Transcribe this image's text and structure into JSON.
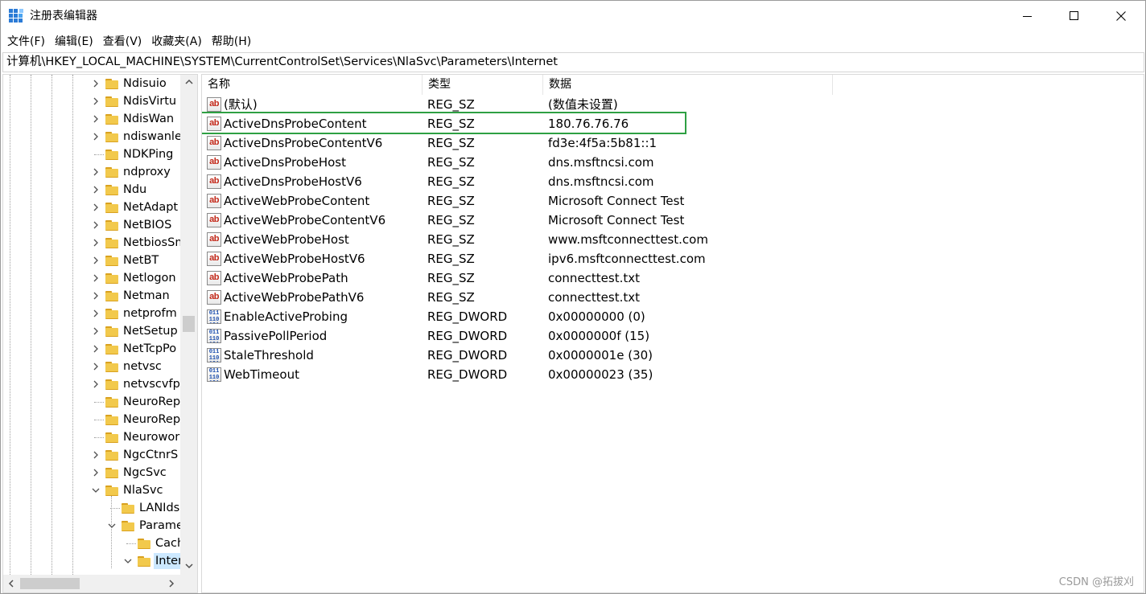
{
  "window": {
    "title": "注册表编辑器",
    "minimize_label": "",
    "maximize_label": "",
    "close_label": ""
  },
  "menu": [
    "文件(F)",
    "编辑(E)",
    "查看(V)",
    "收藏夹(A)",
    "帮助(H)"
  ],
  "address": "计算机\\HKEY_LOCAL_MACHINE\\SYSTEM\\CurrentControlSet\\Services\\NlaSvc\\Parameters\\Internet",
  "tree": {
    "items": [
      {
        "label": "Ndisuio",
        "expander": "collapsed",
        "selected": false
      },
      {
        "label": "NdisVirtu",
        "expander": "collapsed",
        "selected": false
      },
      {
        "label": "NdisWan",
        "expander": "collapsed",
        "selected": false
      },
      {
        "label": "ndiswanle",
        "expander": "collapsed",
        "selected": false
      },
      {
        "label": "NDKPing",
        "expander": "none",
        "selected": false
      },
      {
        "label": "ndproxy",
        "expander": "collapsed",
        "selected": false
      },
      {
        "label": "Ndu",
        "expander": "collapsed",
        "selected": false
      },
      {
        "label": "NetAdapt",
        "expander": "collapsed",
        "selected": false
      },
      {
        "label": "NetBIOS",
        "expander": "collapsed",
        "selected": false
      },
      {
        "label": "NetbiosSm",
        "expander": "collapsed",
        "selected": false
      },
      {
        "label": "NetBT",
        "expander": "collapsed",
        "selected": false
      },
      {
        "label": "Netlogon",
        "expander": "collapsed",
        "selected": false
      },
      {
        "label": "Netman",
        "expander": "collapsed",
        "selected": false
      },
      {
        "label": "netprofm",
        "expander": "collapsed",
        "selected": false
      },
      {
        "label": "NetSetup",
        "expander": "collapsed",
        "selected": false
      },
      {
        "label": "NetTcpPo",
        "expander": "collapsed",
        "selected": false
      },
      {
        "label": "netvsc",
        "expander": "collapsed",
        "selected": false
      },
      {
        "label": "netvscvfp",
        "expander": "collapsed",
        "selected": false
      },
      {
        "label": "NeuroRep",
        "expander": "none",
        "selected": false
      },
      {
        "label": "NeuroRep",
        "expander": "none",
        "selected": false
      },
      {
        "label": "Neurowor",
        "expander": "none",
        "selected": false
      },
      {
        "label": "NgcCtnrS",
        "expander": "collapsed",
        "selected": false
      },
      {
        "label": "NgcSvc",
        "expander": "collapsed",
        "selected": false
      },
      {
        "label": "NlaSvc",
        "expander": "expanded",
        "selected": false
      },
      {
        "label": "LANIds",
        "expander": "none",
        "selected": false
      },
      {
        "label": "Parame",
        "expander": "expanded",
        "selected": false
      },
      {
        "label": "Cach",
        "expander": "none",
        "selected": false
      },
      {
        "label": "Inter",
        "expander": "expanded",
        "selected": true
      }
    ]
  },
  "list": {
    "columns": [
      "名称",
      "类型",
      "数据"
    ],
    "rows": [
      {
        "kind": "ab",
        "name": "(默认)",
        "type": "REG_SZ",
        "data": "(数值未设置)"
      },
      {
        "kind": "ab",
        "name": "ActiveDnsProbeContent",
        "type": "REG_SZ",
        "data": "180.76.76.76"
      },
      {
        "kind": "ab",
        "name": "ActiveDnsProbeContentV6",
        "type": "REG_SZ",
        "data": "fd3e:4f5a:5b81::1"
      },
      {
        "kind": "ab",
        "name": "ActiveDnsProbeHost",
        "type": "REG_SZ",
        "data": "dns.msftncsi.com"
      },
      {
        "kind": "ab",
        "name": "ActiveDnsProbeHostV6",
        "type": "REG_SZ",
        "data": "dns.msftncsi.com"
      },
      {
        "kind": "ab",
        "name": "ActiveWebProbeContent",
        "type": "REG_SZ",
        "data": "Microsoft Connect Test"
      },
      {
        "kind": "ab",
        "name": "ActiveWebProbeContentV6",
        "type": "REG_SZ",
        "data": "Microsoft Connect Test"
      },
      {
        "kind": "ab",
        "name": "ActiveWebProbeHost",
        "type": "REG_SZ",
        "data": "www.msftconnecttest.com"
      },
      {
        "kind": "ab",
        "name": "ActiveWebProbeHostV6",
        "type": "REG_SZ",
        "data": "ipv6.msftconnecttest.com"
      },
      {
        "kind": "ab",
        "name": "ActiveWebProbePath",
        "type": "REG_SZ",
        "data": "connecttest.txt"
      },
      {
        "kind": "ab",
        "name": "ActiveWebProbePathV6",
        "type": "REG_SZ",
        "data": "connecttest.txt"
      },
      {
        "kind": "bin",
        "name": "EnableActiveProbing",
        "type": "REG_DWORD",
        "data": "0x00000000 (0)"
      },
      {
        "kind": "bin",
        "name": "PassivePollPeriod",
        "type": "REG_DWORD",
        "data": "0x0000000f (15)"
      },
      {
        "kind": "bin",
        "name": "StaleThreshold",
        "type": "REG_DWORD",
        "data": "0x0000001e (30)"
      },
      {
        "kind": "bin",
        "name": "WebTimeout",
        "type": "REG_DWORD",
        "data": "0x00000023 (35)"
      }
    ],
    "highlighted_row": 1
  },
  "icons": {
    "string_value": "ab",
    "binary_value": "011 110 101"
  },
  "colors": {
    "highlight_box": "#2ea043",
    "selected_bg": "#cce8ff",
    "folder": "#f2c94c",
    "string_icon": "#c42b1c",
    "binary_icon": "#1d4fae"
  },
  "watermark": "CSDN @拓拔刈"
}
